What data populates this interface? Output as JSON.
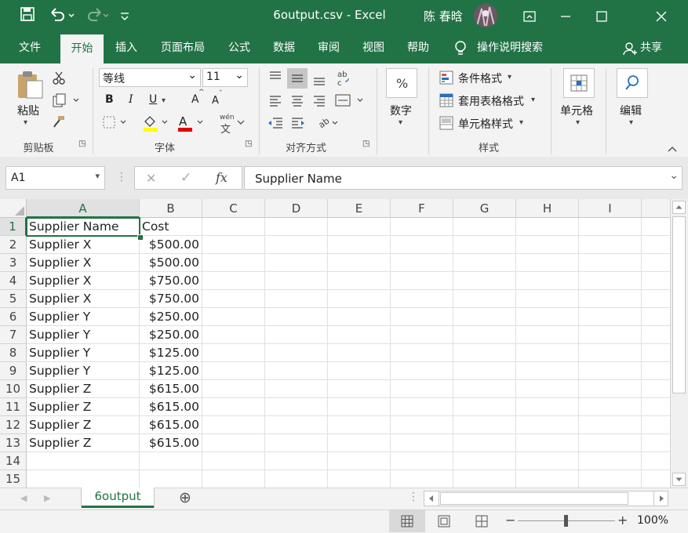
{
  "titlebar": {
    "save_icon": "save-icon",
    "undo_icon": "undo-icon",
    "redo_icon": "redo-icon",
    "customize_icon": "customize-qat-icon",
    "title": "6output.csv  -  Excel",
    "user_name": "陈 春晗",
    "ribbon_display_icon": "ribbon-display-icon",
    "colors": {
      "brand": "#217346"
    }
  },
  "tabs": [
    "文件",
    "开始",
    "插入",
    "页面布局",
    "公式",
    "数据",
    "审阅",
    "视图",
    "帮助"
  ],
  "tell_me": "操作说明搜索",
  "share": "共享",
  "ribbon": {
    "clipboard": {
      "paste": "粘贴",
      "label": "剪贴板"
    },
    "font": {
      "name": "等线",
      "size": "11",
      "bold": "B",
      "italic": "I",
      "underline": "U",
      "grow": "A",
      "shrink": "A",
      "pinyin": "wén",
      "label": "字体"
    },
    "alignment": {
      "label": "对齐方式"
    },
    "number": {
      "percent": "%",
      "label": "数字"
    },
    "styles": {
      "conditional": "条件格式",
      "table": "套用表格格式",
      "cell_styles": "单元格样式",
      "label": "样式"
    },
    "cells": {
      "label": "单元格"
    },
    "editing": {
      "label": "编辑"
    }
  },
  "formula_bar": {
    "name_box": "A1",
    "cancel": "✕",
    "enter": "✓",
    "fx": "fx",
    "content": "Supplier Name"
  },
  "columns": [
    "A",
    "B",
    "C",
    "D",
    "E",
    "F",
    "G",
    "H",
    "I"
  ],
  "rows": [
    {
      "num": "1",
      "a": "Supplier Name",
      "b": "Cost"
    },
    {
      "num": "2",
      "a": "Supplier X",
      "b": "$500.00"
    },
    {
      "num": "3",
      "a": "Supplier X",
      "b": "$500.00"
    },
    {
      "num": "4",
      "a": "Supplier X",
      "b": "$750.00"
    },
    {
      "num": "5",
      "a": "Supplier X",
      "b": "$750.00"
    },
    {
      "num": "6",
      "a": "Supplier Y",
      "b": "$250.00"
    },
    {
      "num": "7",
      "a": "Supplier Y",
      "b": "$250.00"
    },
    {
      "num": "8",
      "a": "Supplier Y",
      "b": "$125.00"
    },
    {
      "num": "9",
      "a": "Supplier Y",
      "b": "$125.00"
    },
    {
      "num": "10",
      "a": "Supplier Z",
      "b": "$615.00"
    },
    {
      "num": "11",
      "a": "Supplier Z",
      "b": "$615.00"
    },
    {
      "num": "12",
      "a": "Supplier Z",
      "b": "$615.00"
    },
    {
      "num": "13",
      "a": "Supplier Z",
      "b": "$615.00"
    },
    {
      "num": "14",
      "a": "",
      "b": ""
    },
    {
      "num": "15",
      "a": "",
      "b": ""
    }
  ],
  "sheet": {
    "name": "6output",
    "add": "⊕"
  },
  "status": {
    "zoom": "100%",
    "minus": "−",
    "plus": "+"
  }
}
